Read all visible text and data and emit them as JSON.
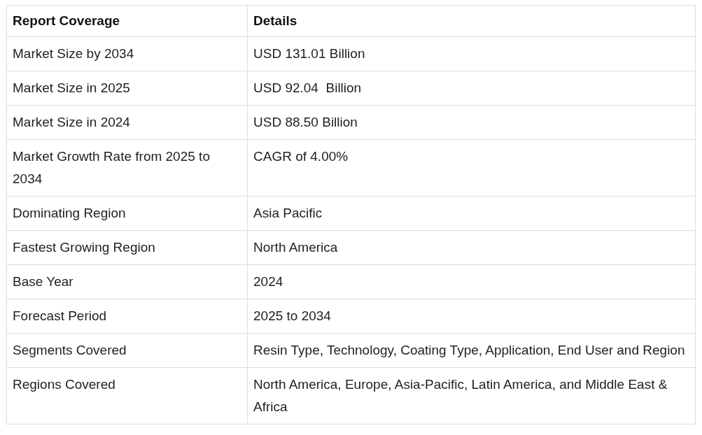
{
  "table": {
    "columns": [
      "Report Coverage",
      "Details"
    ],
    "rows": [
      [
        "Market Size by 2034",
        "USD 131.01 Billion"
      ],
      [
        "Market Size in 2025",
        "USD 92.04  Billion"
      ],
      [
        "Market Size in 2024",
        "USD 88.50 Billion"
      ],
      [
        "Market Growth Rate from 2025 to 2034",
        "CAGR of 4.00%"
      ],
      [
        "Dominating Region",
        "Asia Pacific"
      ],
      [
        "Fastest Growing Region",
        "North America"
      ],
      [
        "Base Year",
        "2024"
      ],
      [
        "Forecast Period",
        "2025 to 2034"
      ],
      [
        "Segments Covered",
        "Resin Type, Technology, Coating Type, Application, End User and Region"
      ],
      [
        "Regions Covered",
        "North America, Europe, Asia-Pacific, Latin America, and Middle East & Africa"
      ]
    ]
  }
}
